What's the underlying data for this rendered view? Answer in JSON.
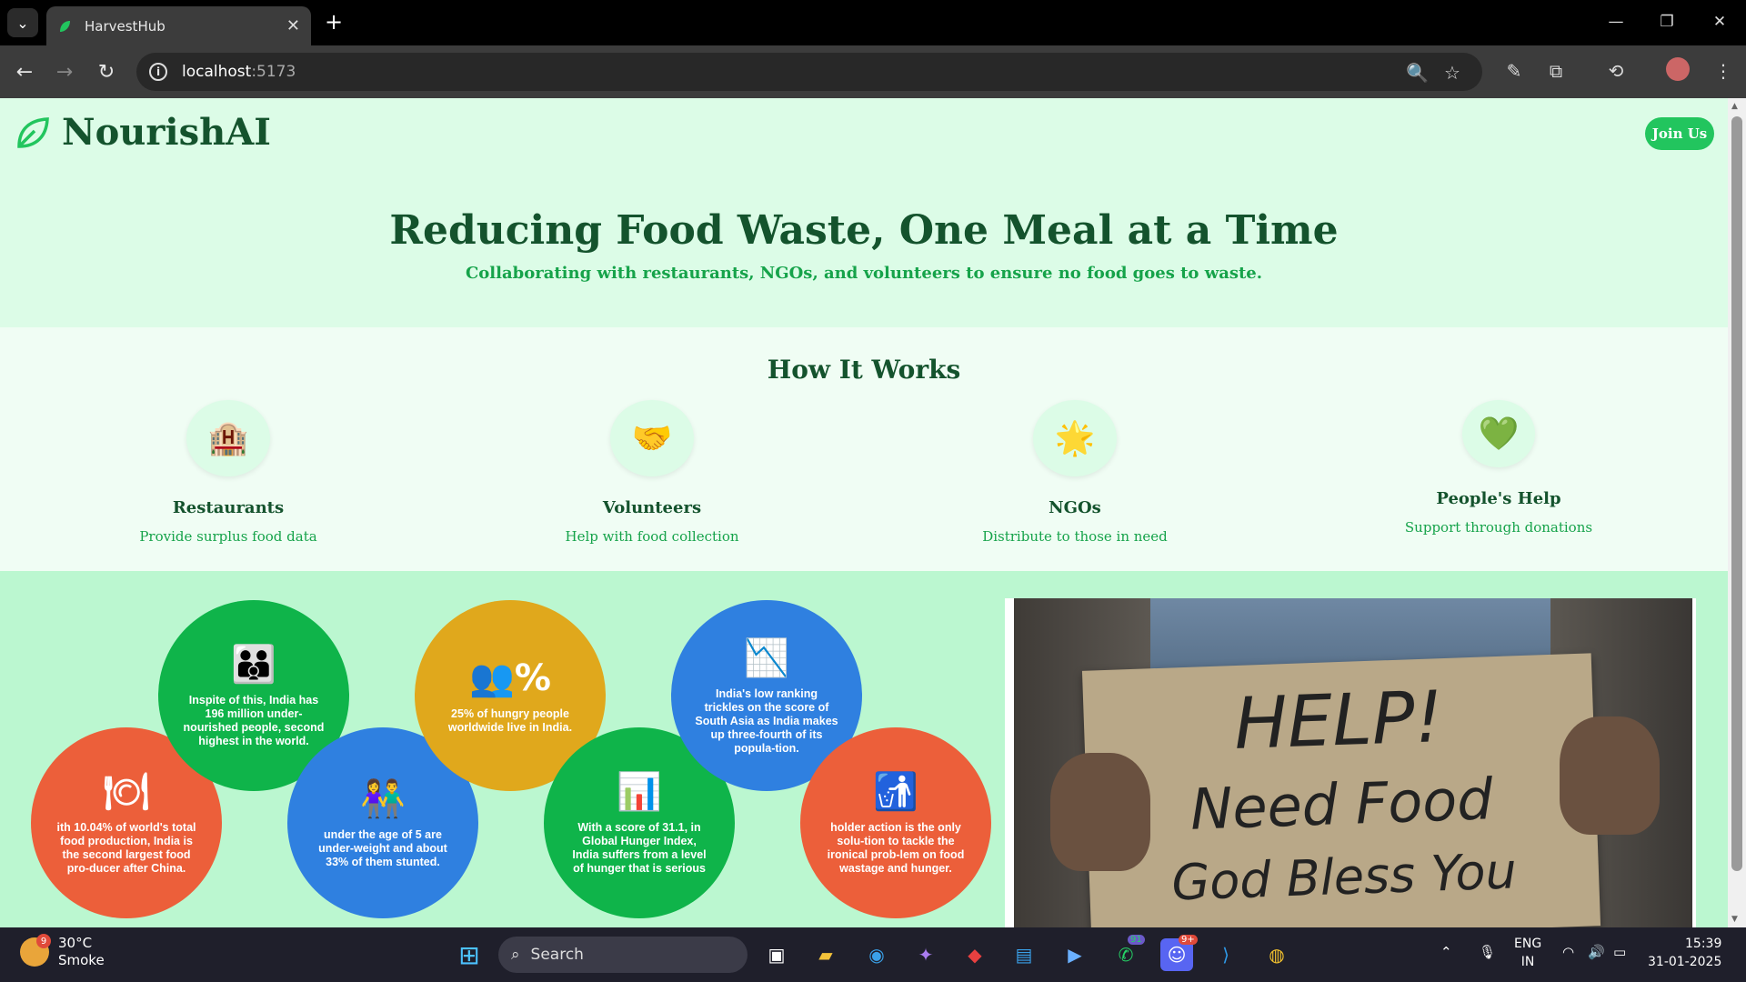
{
  "browser": {
    "tab_title": "HarvestHub",
    "url_host": "localhost",
    "url_port": ":5173"
  },
  "header": {
    "logo_text": "NourishAI",
    "join_label": "Join Us"
  },
  "hero": {
    "title": "Reducing Food Waste, One Meal at a Time",
    "subtitle": "Collaborating with restaurants, NGOs, and volunteers to ensure no food goes to waste."
  },
  "how": {
    "title": "How It Works",
    "cards": [
      {
        "icon": "🏨",
        "title": "Restaurants",
        "desc": "Provide surplus food data"
      },
      {
        "icon": "🤝",
        "title": "Volunteers",
        "desc": "Help with food collection"
      },
      {
        "icon": "🌟",
        "title": "NGOs",
        "desc": "Distribute to those in need"
      },
      {
        "icon": "💚",
        "title": "People's Help",
        "desc": "Support through donations"
      }
    ]
  },
  "infographic": {
    "bubbles": [
      {
        "color": "#ec5f3a",
        "icon": "🍽",
        "text": "ith 10.04% of world's total food production, India is the second largest food pro-ducer after China."
      },
      {
        "color": "#0fb44a",
        "icon": "👪",
        "text": "Inspite of this, India has 196 million under-nourished people, second highest in the world."
      },
      {
        "color": "#2f80e0",
        "icon": "👫",
        "text": "under the age of 5 are under-weight and about 33% of them stunted."
      },
      {
        "color": "#e0a81c",
        "icon": "👥%",
        "text": "25% of hungry people worldwide live in India."
      },
      {
        "color": "#0fb44a",
        "icon": "📊",
        "text": "With a score of 31.1, in Global Hunger Index,  India suffers from a level of hunger that is serious"
      },
      {
        "color": "#2f80e0",
        "icon": "📉",
        "text": "India's low ranking trickles on the score of South Asia as India makes up three-fourth of its popula-tion."
      },
      {
        "color": "#ec5f3a",
        "icon": "🚮",
        "text": "holder action is the only solu-tion to tackle the ironical prob-lem on food wastage and hunger."
      }
    ]
  },
  "photo": {
    "sign_line1": "HELP!",
    "sign_line2": "Need Food",
    "sign_line3": "God Bless You"
  },
  "taskbar": {
    "weather_temp": "30°C",
    "weather_desc": "Smoke",
    "weather_badge": "9",
    "search_label": "Search",
    "lang_top": "ENG",
    "lang_bottom": "IN",
    "time": "15:39",
    "date": "31-01-2025",
    "whatsapp_badge": "91",
    "discord_badge": "9+"
  }
}
